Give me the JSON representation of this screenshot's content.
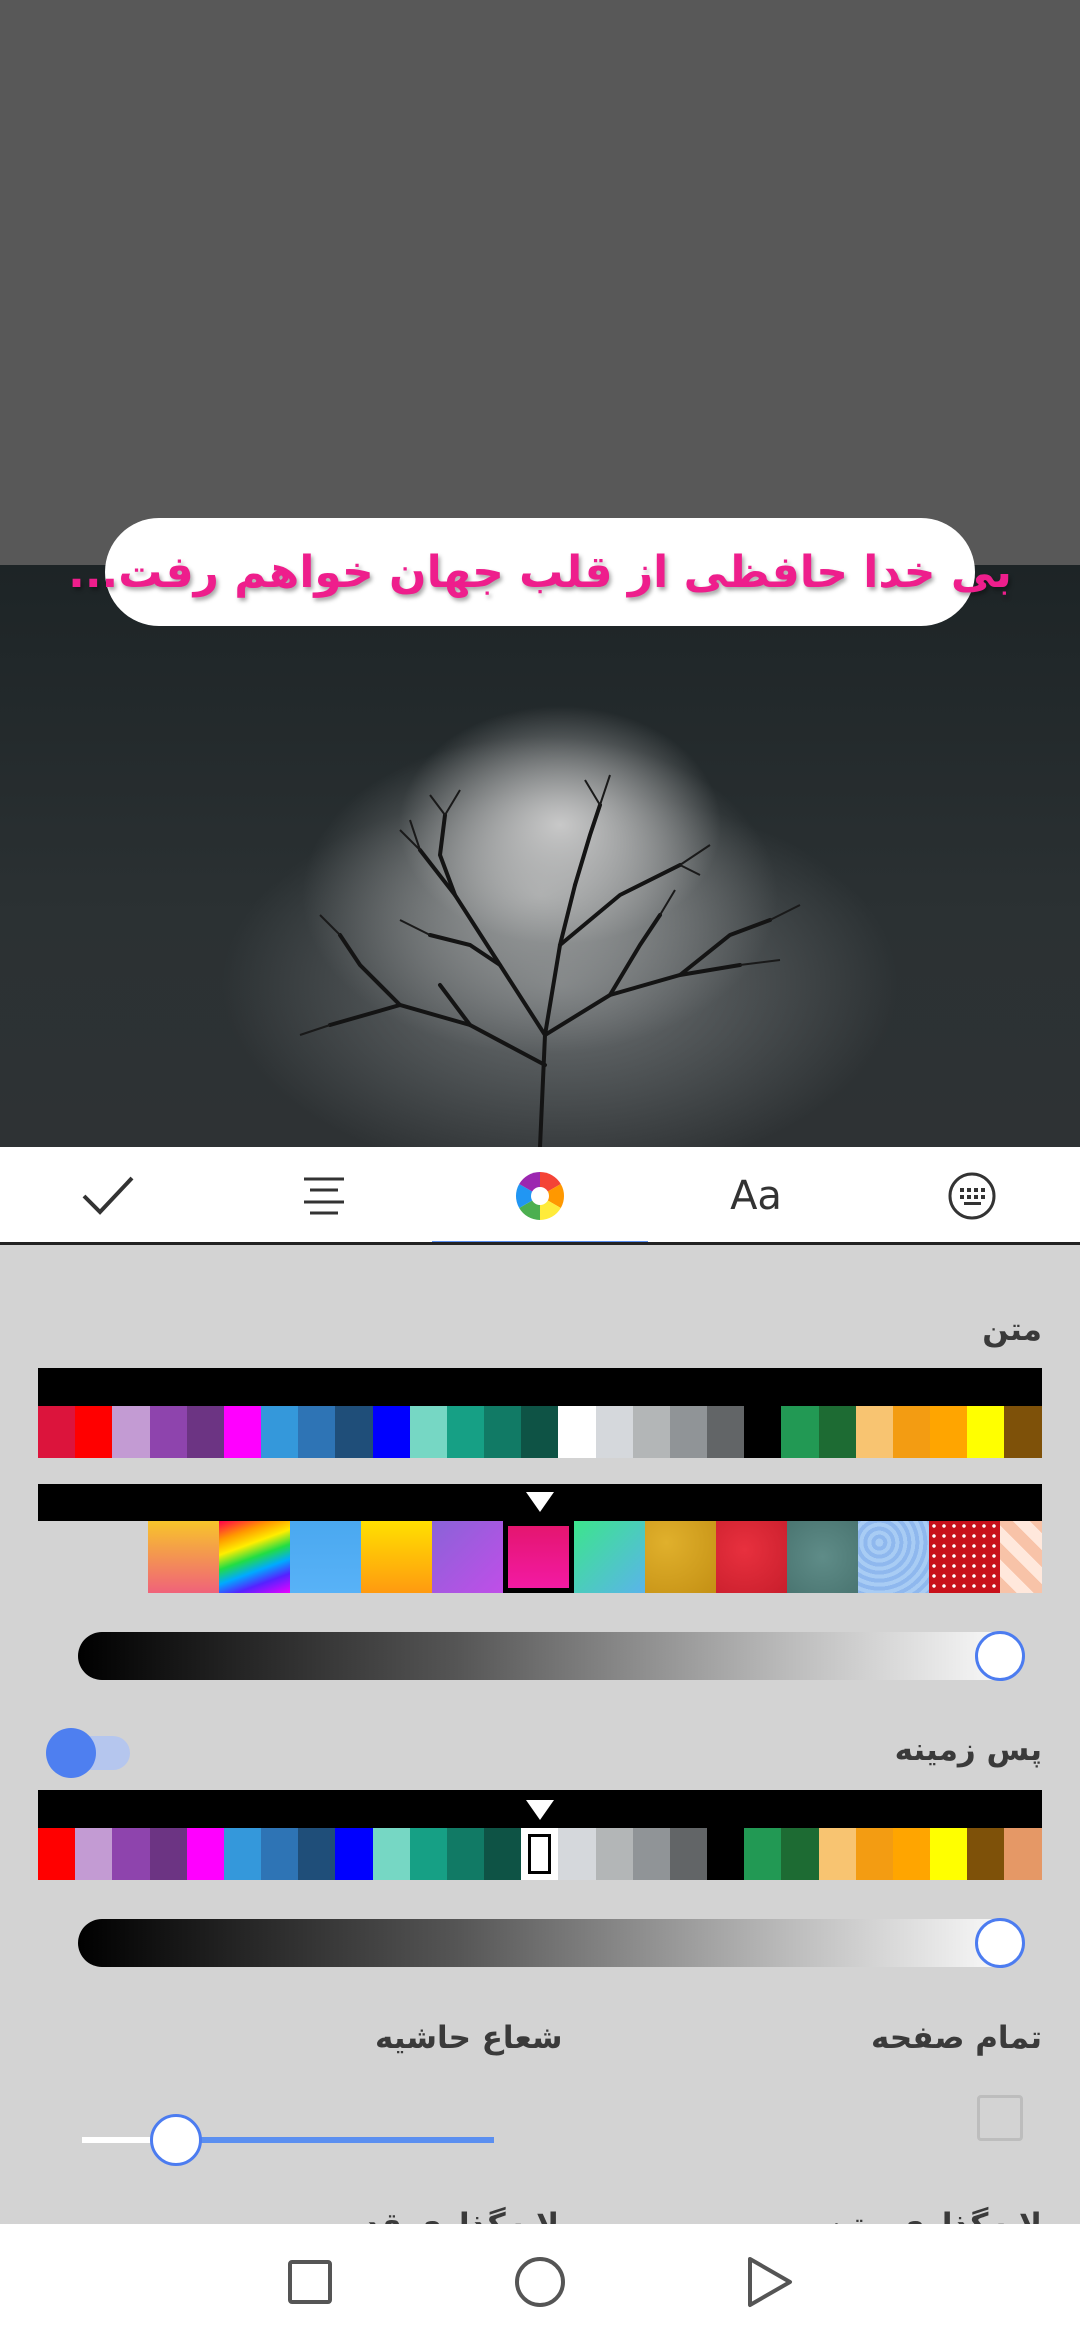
{
  "caption": {
    "text": "بی خدا حافظی از قلب جهان خواهم رفت..."
  },
  "toolbar": {
    "tabs": [
      {
        "name": "confirm",
        "icon": "check-icon",
        "active": false
      },
      {
        "name": "alignment",
        "icon": "align-center-icon",
        "active": false
      },
      {
        "name": "color",
        "icon": "color-wheel-icon",
        "active": true
      },
      {
        "name": "font",
        "icon": "font-icon",
        "label": "Aa",
        "active": false
      },
      {
        "name": "keyboard",
        "icon": "keyboard-icon",
        "active": false
      }
    ]
  },
  "text_section": {
    "label": "متن",
    "colors": [
      "#dc143c",
      "#ff0000",
      "#c39bd3",
      "#8e44ad",
      "#6c3483",
      "#ff00ff",
      "#3498db",
      "#2e74b5",
      "#1f4e79",
      "#0000ff",
      "#76d7c4",
      "#16a085",
      "#117a65",
      "#0e5345",
      "#ffffff",
      "#d5d8dc",
      "#b3b6b7",
      "#909497",
      "#626567",
      "#000000",
      "#229954",
      "#1d6b33",
      "#f8c471",
      "#f39c12",
      "#ffa500",
      "#ffff00",
      "#7e5109"
    ],
    "patterns": [
      "gradient-orange-pink",
      "rainbow",
      "light-blue",
      "yellow-orange",
      "purple-violet",
      "pink-red",
      "green-teal",
      "gold-texture",
      "red-texture",
      "teal-texture",
      "blue-pattern",
      "red-dots",
      "peach-check"
    ],
    "selected_pattern_index": 5,
    "opacity_percent": 100
  },
  "background_section": {
    "label": "پس زمینه",
    "enabled": true,
    "colors": [
      "#ff0000",
      "#c39bd3",
      "#8e44ad",
      "#6c3483",
      "#ff00ff",
      "#3498db",
      "#2e74b5",
      "#1f4e79",
      "#0000ff",
      "#76d7c4",
      "#16a085",
      "#117a65",
      "#0e5345",
      "#ffffff",
      "#d5d8dc",
      "#b3b6b7",
      "#909497",
      "#626567",
      "#000000",
      "#229954",
      "#1d6b33",
      "#f8c471",
      "#f39c12",
      "#ffa500",
      "#ffff00",
      "#7e5109",
      "#e59866"
    ],
    "selected_color_index": 13,
    "opacity_percent": 100
  },
  "options": {
    "full_page_label": "تمام صفحه",
    "full_page_checked": false,
    "border_radius_label": "شعاع حاشیه",
    "border_radius_percent": 23,
    "cut_label_right": "لایه‌گذاری متن",
    "cut_label_left": "لایه‌گذاری قدیمی"
  },
  "navbar": {
    "buttons": [
      "recents-icon",
      "home-icon",
      "back-icon"
    ]
  }
}
